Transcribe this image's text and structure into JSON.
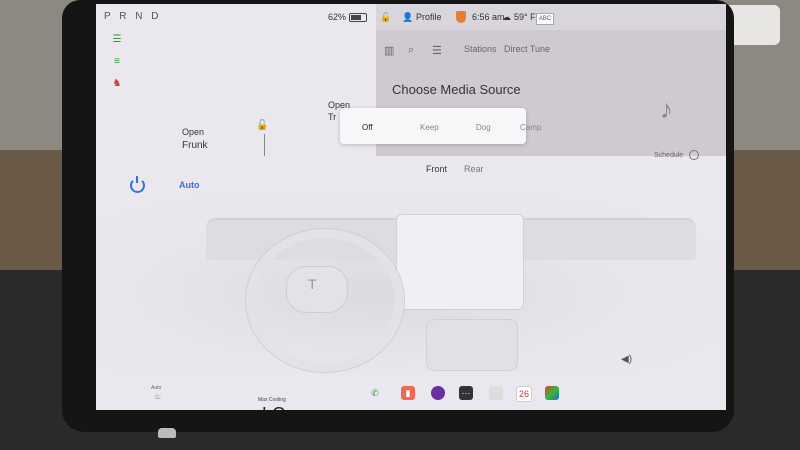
{
  "status": {
    "gears": "P R N D",
    "battery": "62%",
    "profile": "Profile",
    "time": "6:56 am",
    "temperature": "59° F",
    "temp_badge": "ABC"
  },
  "car_panel": {
    "frunk_open": "Open",
    "frunk_label": "Frunk",
    "trunk_open": "Open",
    "trunk_label": "Tr"
  },
  "media": {
    "tabs": [
      "Stations",
      "Direct Tune"
    ],
    "heading": "Choose Media Source"
  },
  "camp_popup": {
    "options": [
      "Off",
      "Keep",
      "Dog",
      "Camp"
    ]
  },
  "climate": {
    "auto": "Auto",
    "front": "Front",
    "rear": "Rear",
    "schedule": "Schedule"
  },
  "dock": {
    "mode": "Max Cooling",
    "temp": "LO",
    "calendar_day": "26",
    "seat_auto": "Auto"
  },
  "colors": {
    "accent": "#3a6fd8",
    "screen_bg": "#ebe7ef",
    "media_bg": "#cfcad2"
  }
}
